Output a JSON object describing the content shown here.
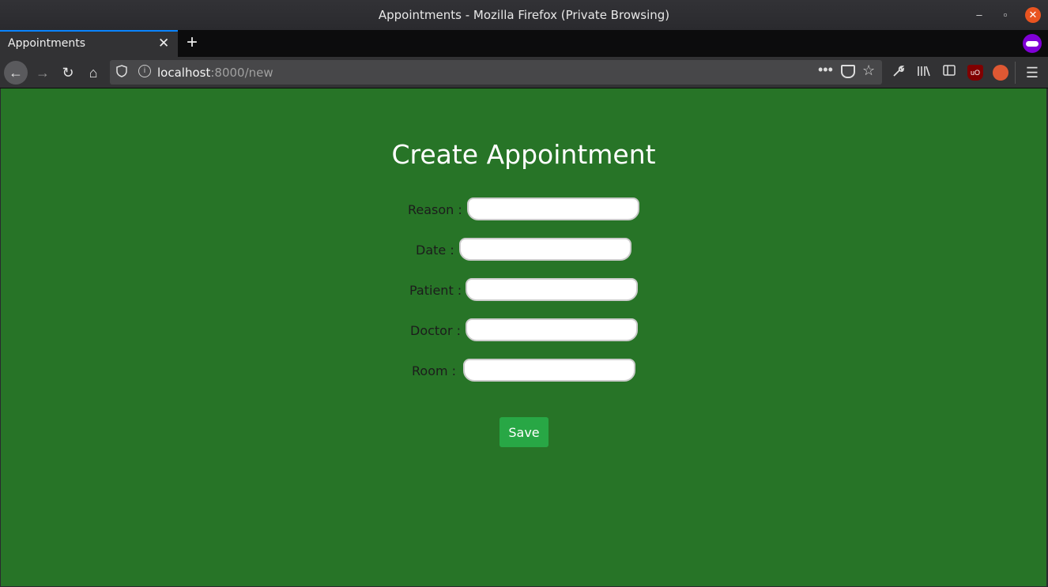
{
  "window": {
    "title": "Appointments - Mozilla Firefox (Private Browsing)",
    "minimize_icon": "–",
    "maximize_icon": "▫",
    "close_icon": "✕"
  },
  "tabs": [
    {
      "title": "Appointments",
      "active": true
    }
  ],
  "tabbar": {
    "close_icon": "✕",
    "newtab_icon": "+"
  },
  "navbar": {
    "back_icon": "←",
    "forward_icon": "→",
    "reload_icon": "↻",
    "home_icon": "⌂",
    "url_host": "localhost",
    "url_rest": ":8000/new",
    "more_icon": "•••",
    "star_icon": "☆",
    "menu_icon": "☰"
  },
  "page": {
    "title": "Create Appointment",
    "fields": [
      {
        "label": "Reason :",
        "value": ""
      },
      {
        "label": "Date :",
        "value": ""
      },
      {
        "label": "Patient :",
        "value": ""
      },
      {
        "label": "Doctor :",
        "value": ""
      },
      {
        "label": "Room :",
        "value": ""
      }
    ],
    "save_label": "Save"
  },
  "colors": {
    "page_background": "#277427",
    "save_button": "#28a745",
    "active_tab_accent": "#0a84ff"
  }
}
